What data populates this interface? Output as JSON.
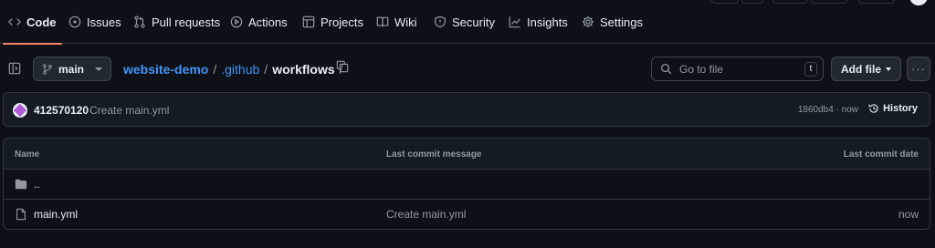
{
  "nav": {
    "tabs": [
      {
        "label": "Code",
        "icon": "code-icon",
        "active": true
      },
      {
        "label": "Issues",
        "icon": "issue-icon"
      },
      {
        "label": "Pull requests",
        "icon": "pull-request-icon"
      },
      {
        "label": "Actions",
        "icon": "play-icon"
      },
      {
        "label": "Projects",
        "icon": "table-icon"
      },
      {
        "label": "Wiki",
        "icon": "book-icon"
      },
      {
        "label": "Security",
        "icon": "shield-icon"
      },
      {
        "label": "Insights",
        "icon": "graph-icon"
      },
      {
        "label": "Settings",
        "icon": "gear-icon"
      }
    ]
  },
  "path_bar": {
    "branch": "main",
    "repo": "website-demo",
    "crumbs": [
      ".github"
    ],
    "current": "workflows",
    "separator": "/",
    "search_placeholder": "Go to file",
    "search_shortcut": "t",
    "add_file_label": "Add file",
    "more_label": "···"
  },
  "latest_commit": {
    "author": "412570120",
    "message": "Create main.yml",
    "meta": "1860db4 · now",
    "history_label": "History"
  },
  "file_table": {
    "headers": {
      "name": "Name",
      "message": "Last commit message",
      "date": "Last commit date"
    },
    "parent_dir": "..",
    "rows": [
      {
        "name": "main.yml",
        "message": "Create main.yml",
        "date": "now",
        "icon": "file-icon"
      }
    ]
  },
  "colors": {
    "background": "#0d1117",
    "accent_underline": "#f78166",
    "link": "#4493f8",
    "border": "#30363d"
  }
}
